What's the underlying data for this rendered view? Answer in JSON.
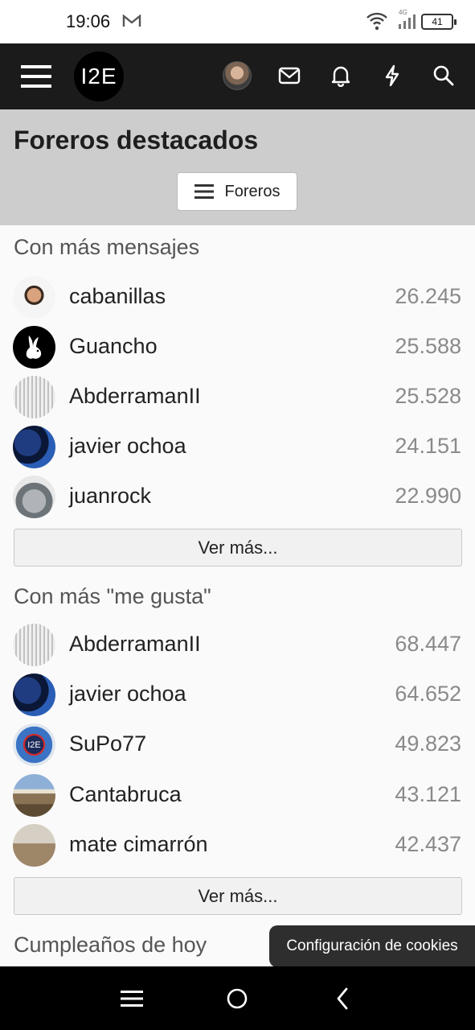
{
  "status_bar": {
    "time": "19:06",
    "battery": "41",
    "network": "4G"
  },
  "nav": {
    "logo_text": "I2E"
  },
  "page": {
    "title": "Foreros destacados",
    "filter_label": "Foreros"
  },
  "sections": [
    {
      "heading": "Con más mensajes",
      "users": [
        {
          "name": "cabanillas",
          "count": "26.245",
          "avatar": "av-cab"
        },
        {
          "name": "Guancho",
          "count": "25.588",
          "avatar": "av-gua"
        },
        {
          "name": "AbderramanII",
          "count": "25.528",
          "avatar": "av-abd"
        },
        {
          "name": "javier ochoa",
          "count": "24.151",
          "avatar": "av-jav"
        },
        {
          "name": "juanrock",
          "count": "22.990",
          "avatar": "av-jua"
        }
      ],
      "more_label": "Ver más..."
    },
    {
      "heading": "Con más \"me gusta\"",
      "users": [
        {
          "name": "AbderramanII",
          "count": "68.447",
          "avatar": "av-abd"
        },
        {
          "name": "javier ochoa",
          "count": "64.652",
          "avatar": "av-jav"
        },
        {
          "name": "SuPo77",
          "count": "49.823",
          "avatar": "av-sup"
        },
        {
          "name": "Cantabruca",
          "count": "43.121",
          "avatar": "av-can"
        },
        {
          "name": "mate cimarrón",
          "count": "42.437",
          "avatar": "av-mat"
        }
      ],
      "more_label": "Ver más..."
    },
    {
      "heading": "Cumpleaños de hoy"
    }
  ],
  "cookie_toast": "Configuración de cookies",
  "icons": {
    "menu": "hamburger-menu-icon",
    "mail": "envelope-icon",
    "bell": "bell-icon",
    "bolt": "lightning-icon",
    "search": "search-icon"
  }
}
